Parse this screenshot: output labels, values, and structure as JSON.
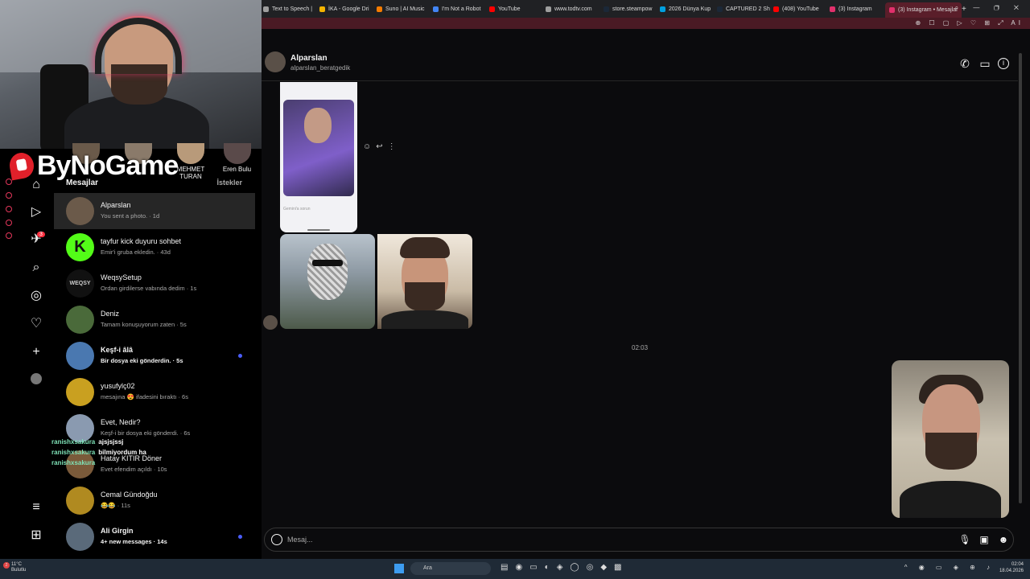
{
  "browser": {
    "tabs": [
      {
        "label": "Text to Speech |",
        "color": "#9e9e9e"
      },
      {
        "label": "İKA - Google Dri",
        "color": "#f4b400"
      },
      {
        "label": "Suno | AI Music",
        "color": "#f57c00"
      },
      {
        "label": "I'm Not a Robot",
        "color": "#4285f4"
      },
      {
        "label": "YouTube",
        "color": "#ff0000"
      },
      {
        "label": "www.todtv.com",
        "color": "#9e9e9e"
      },
      {
        "label": "store.steampow",
        "color": "#1b2838"
      },
      {
        "label": "2026 Dünya Kup",
        "color": "#00a0e0"
      },
      {
        "label": "CAPTURED 2 Sh",
        "color": "#1b2838"
      },
      {
        "label": "(408) YouTube",
        "color": "#ff0000"
      },
      {
        "label": "(3) Instagram",
        "color": "#e1306c"
      },
      {
        "label": "(3) Instagram • Mesajlar",
        "color": "#e1306c",
        "active": true
      }
    ],
    "new_tab_glyph": "+",
    "window_controls": "⌕ — ❐ ✕",
    "toolbar_icons": "⊕ ☐ ▢ ▷ ♡ ⊞ ⤢ AI"
  },
  "overlay": {
    "logo_text": "ByNoGame",
    "chat": [
      {
        "user": "ranishxsakura",
        "message": "ajsjsjssj"
      },
      {
        "user": "ranishxsakura",
        "message": "bilmiyordum ha"
      },
      {
        "user": "ranishxsakura",
        "message": ""
      }
    ]
  },
  "stories": [
    {
      "name": ""
    },
    {
      "name": ""
    },
    {
      "name": "MEHMET TURAN"
    },
    {
      "name": "Eren Bulu"
    }
  ],
  "nav": {
    "badge_count": "3"
  },
  "inbox": {
    "title": "Mesajlar",
    "requests_label": "İstekler",
    "conversations": [
      {
        "name": "Alparslan",
        "preview": "You sent a photo. · 1d",
        "active": true,
        "unread": false,
        "color": "#6b5a4a"
      },
      {
        "name": "tayfur kick duyuru sohbet",
        "preview": "Emir'i gruba ekledin. · 43d",
        "unread": false,
        "color": "#53fc18",
        "avatar_text": "K"
      },
      {
        "name": "WeqsySetup",
        "preview": "Ordan girdilerse vabında dedim · 1s",
        "unread": false,
        "color": "#111111",
        "avatar_text": "WEQSY"
      },
      {
        "name": "Deniz",
        "preview": "Tamam konuşuyorum zaten · 5s",
        "unread": false,
        "color": "#4a6a3a"
      },
      {
        "name": "Keşf-i âlâ",
        "preview": "Bir dosya eki gönderdin. · 5s",
        "unread": true,
        "color": "#4a78b0"
      },
      {
        "name": "yusufylç02",
        "preview": "mesajına 😍 ifadesini bıraktı · 6s",
        "unread": false,
        "color": "#c9a020"
      },
      {
        "name": "Evet, Nedir?",
        "preview": "Keşf-i bir dosya eki gönderdi. · 6s",
        "unread": false,
        "color": "#8a9ab0"
      },
      {
        "name": "Hatay KITIR Döner",
        "preview": "Evet efendim açıldı · 10s",
        "unread": false,
        "color": "#7a5a3a"
      },
      {
        "name": "Cemal Gündoğdu",
        "preview": "😂😂 · 11s",
        "unread": false,
        "color": "#b08a20"
      },
      {
        "name": "Ali Girgin",
        "preview": "4+ new messages · 14s",
        "unread": true,
        "color": "#5a6a7a"
      }
    ]
  },
  "thread": {
    "name": "Alparslan",
    "handle": "alparslan_beratgedik",
    "timestamp": "02:03",
    "composer_placeholder": "Mesaj...",
    "phone_caption": "Gemini'a sorun"
  },
  "taskbar": {
    "weather_temp": "11°C",
    "weather_desc": "Bulutlu",
    "weather_badge": "2",
    "search_label": "Ara",
    "time": "02:04",
    "date": "18.04.2026"
  },
  "colors": {
    "accent": "#4a5df9",
    "badge": "#ff3040",
    "tab_active": "#5a1e2a"
  }
}
